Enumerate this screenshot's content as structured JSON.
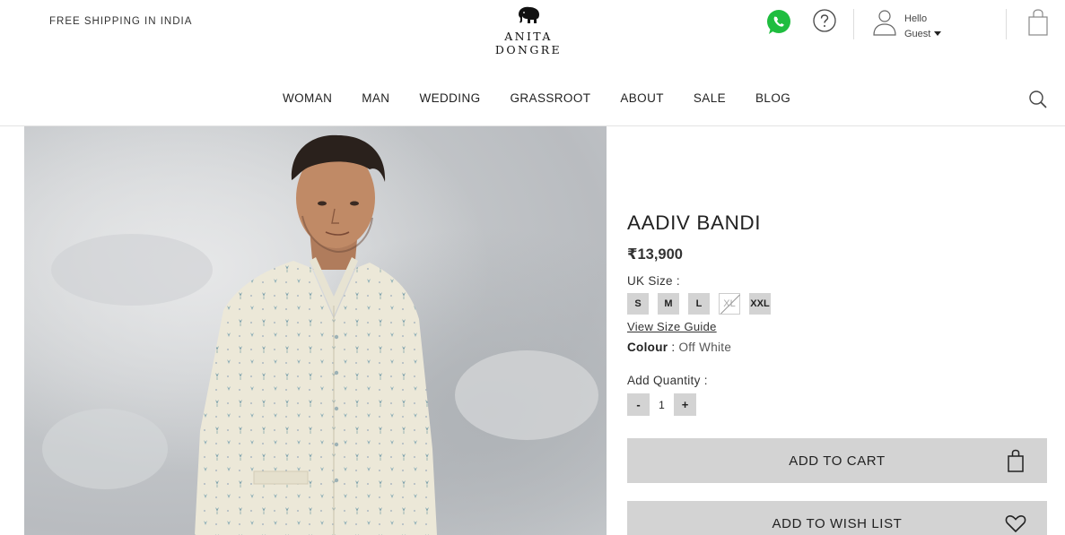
{
  "header": {
    "shipping_text": "FREE SHIPPING IN INDIA",
    "brand_name": "ANITA DONGRE",
    "user_greeting": "Hello",
    "user_name": "Guest"
  },
  "nav": {
    "items": [
      "WOMAN",
      "MAN",
      "WEDDING",
      "GRASSROOT",
      "ABOUT",
      "SALE",
      "BLOG"
    ]
  },
  "product": {
    "title": "AADIV BANDI",
    "price": "₹13,900",
    "size_label": "UK Size",
    "size_sep": " :",
    "sizes": [
      {
        "label": "S",
        "available": true
      },
      {
        "label": "M",
        "available": true
      },
      {
        "label": "L",
        "available": true
      },
      {
        "label": "XL",
        "available": false
      },
      {
        "label": "XXL",
        "available": true
      }
    ],
    "size_guide": "View Size Guide",
    "colour_label": "Colour",
    "colour_sep": " : ",
    "colour_value": "Off White",
    "quantity_label": "Add Quantity :",
    "qty_minus": "-",
    "qty_value": "1",
    "qty_plus": "+"
  },
  "actions": {
    "add_to_cart": "ADD TO CART",
    "add_to_wishlist": "ADD TO WISH LIST"
  },
  "icons": {
    "whatsapp": "whatsapp-icon",
    "help": "help-icon",
    "user": "user-icon",
    "bag": "shopping-bag-icon",
    "search": "search-icon",
    "heart": "heart-icon"
  },
  "colors": {
    "whatsapp_green": "#1fbd3f",
    "button_gray": "#d3d3d3"
  }
}
